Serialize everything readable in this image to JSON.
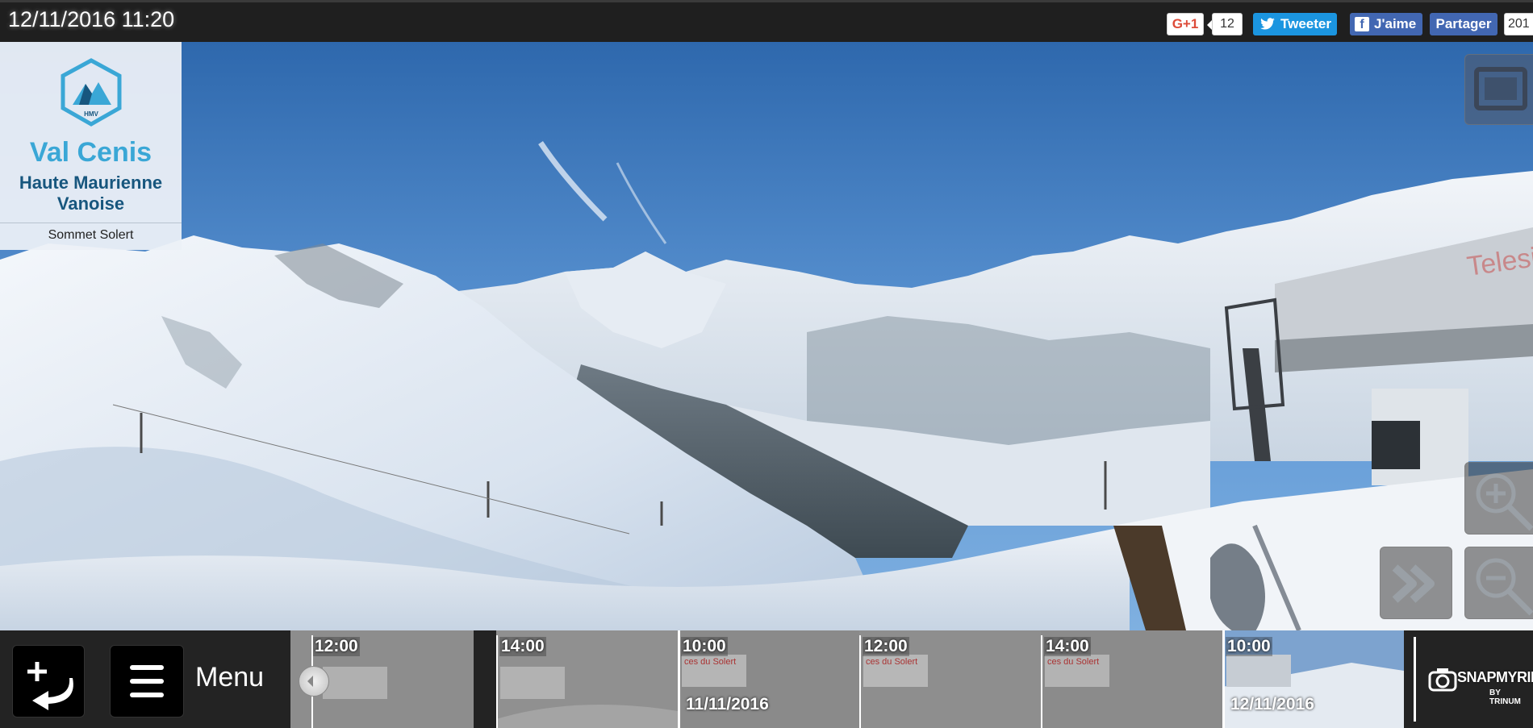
{
  "header": {
    "datetime": "12/11/2016 11:20"
  },
  "social": {
    "gplus_label": "G+1",
    "gplus_count": "12",
    "tweet_label": "Tweeter",
    "fb_like_label": "J'aime",
    "fb_share_label": "Partager",
    "fb_share_count": "201"
  },
  "logo": {
    "badge_text": "HMV",
    "title": "Val Cenis",
    "subtitle_line1": "Haute Maurienne",
    "subtitle_line2": "Vanoise",
    "location": "Sommet Solert"
  },
  "gondola_sign": "Telesie",
  "bottom": {
    "menu_label": "Menu"
  },
  "timeline": {
    "thumbnails": [
      {
        "time": "12:00",
        "date": ""
      },
      {
        "time": "14:00",
        "date": ""
      },
      {
        "time": "10:00",
        "date": "11/11/2016"
      },
      {
        "time": "12:00",
        "date": ""
      },
      {
        "time": "14:00",
        "date": ""
      },
      {
        "time": "10:00",
        "date": "12/11/2016"
      }
    ],
    "thumb_caption": "ces du Solert"
  },
  "brand": {
    "name": "SNAPMYRIDE",
    "sub": "BY TRINUM"
  },
  "colors": {
    "sky_top": "#2f6bb0",
    "sky_horizon": "#6fa3d9",
    "accent_logo": "#3aa7d6",
    "logo_dark": "#17567e",
    "facebook": "#4267b2",
    "twitter": "#1b95e0",
    "gplus": "#dd4b39"
  }
}
